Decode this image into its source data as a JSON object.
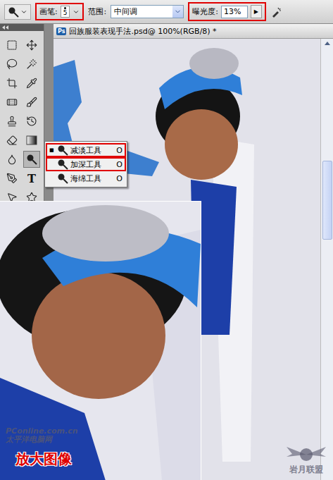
{
  "options_bar": {
    "brush": {
      "label": "画笔:",
      "size": "5",
      "highlighted": true
    },
    "range": {
      "label": "范围:",
      "value": "中间调"
    },
    "exposure": {
      "label": "曝光度:",
      "value": "13%",
      "arrow": "▶",
      "highlighted": true
    }
  },
  "toolbox": {
    "type_tool_glyph": "T"
  },
  "flyout_menu": {
    "marker": "■",
    "items": [
      {
        "label": "减淡工具",
        "shortcut": "O",
        "selected": true,
        "highlighted": true
      },
      {
        "label": "加深工具",
        "shortcut": "O",
        "selected": false,
        "highlighted": true
      },
      {
        "label": "海绵工具",
        "shortcut": "O",
        "selected": false,
        "highlighted": false
      }
    ]
  },
  "document": {
    "ps_badge": "Ps",
    "title": "回族服装表现手法.psd@ 100%(RGB/8) *"
  },
  "inset": {
    "label": "放大图像"
  },
  "watermarks": {
    "left_top": "PConline.com.cn",
    "left_bottom": "太平洋电脑网",
    "right": "岩月联盟"
  }
}
